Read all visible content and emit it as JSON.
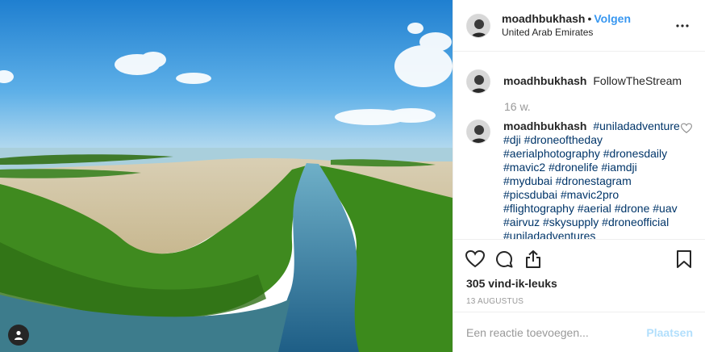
{
  "post": {
    "username": "moadhbukhash",
    "follow_label": "Volgen",
    "separator": "•",
    "location": "United Arab Emirates",
    "comments": [
      {
        "username": "moadhbukhash",
        "text": "FollowTheStream"
      }
    ],
    "time_ago": "16 w.",
    "caption": {
      "username": "moadhbukhash",
      "hashtags": "#uniladadventure #dji #droneoftheday #aerialphotography #dronesdaily #mavic2 #dronelife #iamdji #mydubai #dronestagram #picsdubai #mavic2pro #flightography #aerial #drone #uav #airvuz #skysupply #droneofficial #uniladadventures"
    },
    "likes": "305 vind-ik-leuks",
    "date": "13 AUGUSTUS",
    "comment_placeholder": "Een reactie toevoegen...",
    "post_button": "Plaatsen"
  },
  "icons": {
    "more": "more-options-icon",
    "like": "heart-icon",
    "comment": "comment-icon",
    "share": "share-icon",
    "save": "bookmark-icon",
    "user_tag": "user-tag-icon"
  },
  "colors": {
    "link": "#3897f0",
    "hashtag": "#003569",
    "muted": "#999999",
    "post_button_disabled": "#b2dffc"
  }
}
